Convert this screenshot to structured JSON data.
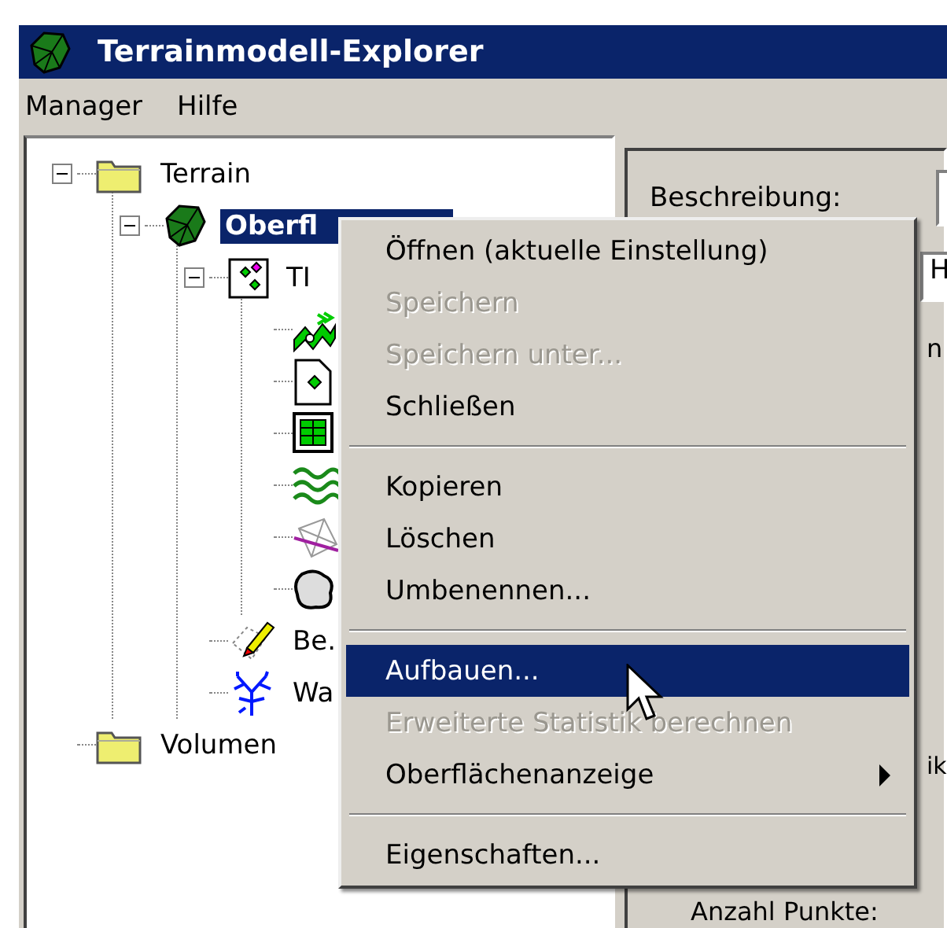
{
  "window": {
    "title": "Terrainmodell-Explorer"
  },
  "menu_bar": [
    "Manager",
    "Hilfe"
  ],
  "tree": [
    {
      "label": "Terrain",
      "kind": "folder",
      "expanded": true,
      "selected": false,
      "children": [
        {
          "label": "Oberfl",
          "kind": "surface",
          "expanded": true,
          "selected": true,
          "children": [
            {
              "label": "TI",
              "kind": "tin",
              "expanded": true,
              "selected": false,
              "children": [
                {
                  "kind": "points"
                },
                {
                  "kind": "file"
                },
                {
                  "kind": "grid"
                },
                {
                  "kind": "contours"
                },
                {
                  "kind": "breakline"
                },
                {
                  "kind": "boundary"
                }
              ]
            },
            {
              "label": "Be.",
              "kind": "edit",
              "selected": false
            },
            {
              "label": "Wa",
              "kind": "water",
              "selected": false
            }
          ]
        }
      ]
    },
    {
      "label": "Volumen",
      "kind": "folder",
      "selected": false
    }
  ],
  "details": {
    "description_label": "Beschreibung:",
    "combo_value": "H",
    "text_1": "n",
    "text_2": "ik",
    "points_label": "Anzahl Punkte:"
  },
  "context_menu": [
    {
      "kind": "item",
      "label": "Öffnen (aktuelle Einstellung)",
      "disabled": false,
      "selected": false,
      "submenu": false
    },
    {
      "kind": "item",
      "label": "Speichern",
      "disabled": true,
      "selected": false,
      "submenu": false
    },
    {
      "kind": "item",
      "label": "Speichern unter...",
      "disabled": true,
      "selected": false,
      "submenu": false
    },
    {
      "kind": "item",
      "label": "Schließen",
      "disabled": false,
      "selected": false,
      "submenu": false
    },
    {
      "kind": "separator"
    },
    {
      "kind": "item",
      "label": "Kopieren",
      "disabled": false,
      "selected": false,
      "submenu": false
    },
    {
      "kind": "item",
      "label": "Löschen",
      "disabled": false,
      "selected": false,
      "submenu": false
    },
    {
      "kind": "item",
      "label": "Umbenennen...",
      "disabled": false,
      "selected": false,
      "submenu": false
    },
    {
      "kind": "separator"
    },
    {
      "kind": "item",
      "label": "Aufbauen...",
      "disabled": false,
      "selected": true,
      "submenu": false
    },
    {
      "kind": "item",
      "label": "Erweiterte Statistik berechnen",
      "disabled": true,
      "selected": false,
      "submenu": false
    },
    {
      "kind": "item",
      "label": "Oberflächenanzeige",
      "disabled": false,
      "selected": false,
      "submenu": true
    },
    {
      "kind": "separator"
    },
    {
      "kind": "item",
      "label": "Eigenschaften...",
      "disabled": false,
      "selected": false,
      "submenu": false
    }
  ]
}
